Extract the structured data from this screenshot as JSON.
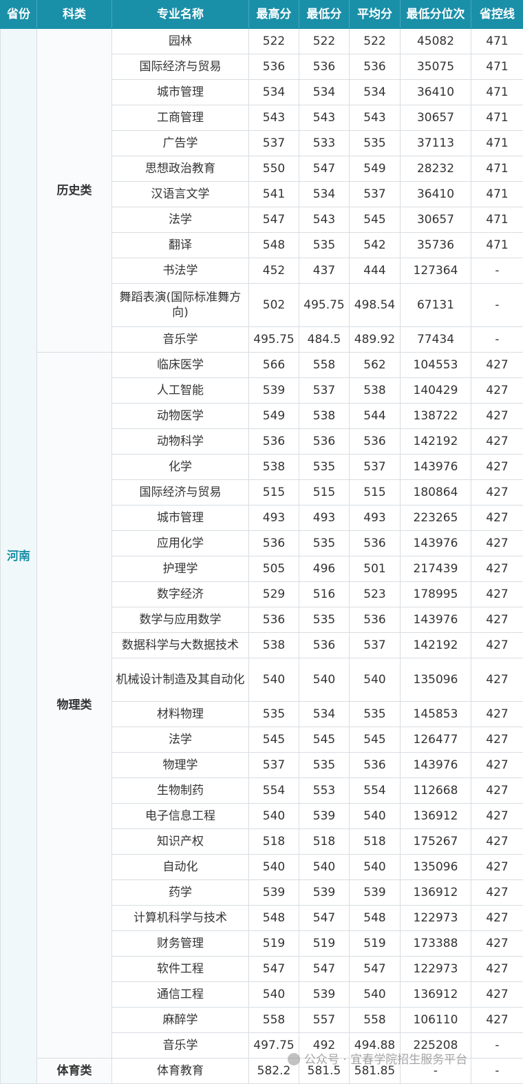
{
  "headers": [
    "省份",
    "科类",
    "专业名称",
    "最高分",
    "最低分",
    "平均分",
    "最低分位次",
    "省控线"
  ],
  "province": "河南",
  "groups": [
    {
      "category": "历史类",
      "rows": [
        [
          "园林",
          "522",
          "522",
          "522",
          "45082",
          "471"
        ],
        [
          "国际经济与贸易",
          "536",
          "536",
          "536",
          "35075",
          "471"
        ],
        [
          "城市管理",
          "534",
          "534",
          "534",
          "36410",
          "471"
        ],
        [
          "工商管理",
          "543",
          "543",
          "543",
          "30657",
          "471"
        ],
        [
          "广告学",
          "537",
          "533",
          "535",
          "37113",
          "471"
        ],
        [
          "思想政治教育",
          "550",
          "547",
          "549",
          "28232",
          "471"
        ],
        [
          "汉语言文学",
          "541",
          "534",
          "537",
          "36410",
          "471"
        ],
        [
          "法学",
          "547",
          "543",
          "545",
          "30657",
          "471"
        ],
        [
          "翻译",
          "548",
          "535",
          "542",
          "35736",
          "471"
        ],
        [
          "书法学",
          "452",
          "437",
          "444",
          "127364",
          "-"
        ],
        [
          "舞蹈表演(国际标准舞方向)",
          "502",
          "495.75",
          "498.54",
          "67131",
          "-"
        ],
        [
          "音乐学",
          "495.75",
          "484.5",
          "489.92",
          "77434",
          "-"
        ]
      ]
    },
    {
      "category": "物理类",
      "rows": [
        [
          "临床医学",
          "566",
          "558",
          "562",
          "104553",
          "427"
        ],
        [
          "人工智能",
          "539",
          "537",
          "538",
          "140429",
          "427"
        ],
        [
          "动物医学",
          "549",
          "538",
          "544",
          "138722",
          "427"
        ],
        [
          "动物科学",
          "536",
          "536",
          "536",
          "142192",
          "427"
        ],
        [
          "化学",
          "538",
          "535",
          "537",
          "143976",
          "427"
        ],
        [
          "国际经济与贸易",
          "515",
          "515",
          "515",
          "180864",
          "427"
        ],
        [
          "城市管理",
          "493",
          "493",
          "493",
          "223265",
          "427"
        ],
        [
          "应用化学",
          "536",
          "535",
          "536",
          "143976",
          "427"
        ],
        [
          "护理学",
          "505",
          "496",
          "501",
          "217439",
          "427"
        ],
        [
          "数字经济",
          "529",
          "516",
          "523",
          "178995",
          "427"
        ],
        [
          "数学与应用数学",
          "536",
          "535",
          "536",
          "143976",
          "427"
        ],
        [
          "数据科学与大数据技术",
          "538",
          "536",
          "537",
          "142192",
          "427"
        ],
        [
          "机械设计制造及其自动化",
          "540",
          "540",
          "540",
          "135096",
          "427"
        ],
        [
          "材料物理",
          "535",
          "534",
          "535",
          "145853",
          "427"
        ],
        [
          "法学",
          "545",
          "545",
          "545",
          "126477",
          "427"
        ],
        [
          "物理学",
          "537",
          "535",
          "536",
          "143976",
          "427"
        ],
        [
          "生物制药",
          "554",
          "553",
          "554",
          "112668",
          "427"
        ],
        [
          "电子信息工程",
          "540",
          "539",
          "540",
          "136912",
          "427"
        ],
        [
          "知识产权",
          "518",
          "518",
          "518",
          "175267",
          "427"
        ],
        [
          "自动化",
          "540",
          "540",
          "540",
          "135096",
          "427"
        ],
        [
          "药学",
          "539",
          "539",
          "539",
          "136912",
          "427"
        ],
        [
          "计算机科学与技术",
          "548",
          "547",
          "548",
          "122973",
          "427"
        ],
        [
          "财务管理",
          "519",
          "519",
          "519",
          "173388",
          "427"
        ],
        [
          "软件工程",
          "547",
          "547",
          "547",
          "122973",
          "427"
        ],
        [
          "通信工程",
          "540",
          "539",
          "540",
          "136912",
          "427"
        ],
        [
          "麻醉学",
          "558",
          "557",
          "558",
          "106110",
          "427"
        ],
        [
          "音乐学",
          "497.75",
          "492",
          "494.88",
          "225208",
          "-"
        ]
      ]
    },
    {
      "category": "体育类",
      "rows": [
        [
          "体育教育",
          "582.2",
          "581.5",
          "581.85",
          "-",
          "-"
        ]
      ]
    }
  ],
  "watermark": {
    "icon": "wechat-icon",
    "text": "公众号 · 宜春学院招生服务平台"
  }
}
